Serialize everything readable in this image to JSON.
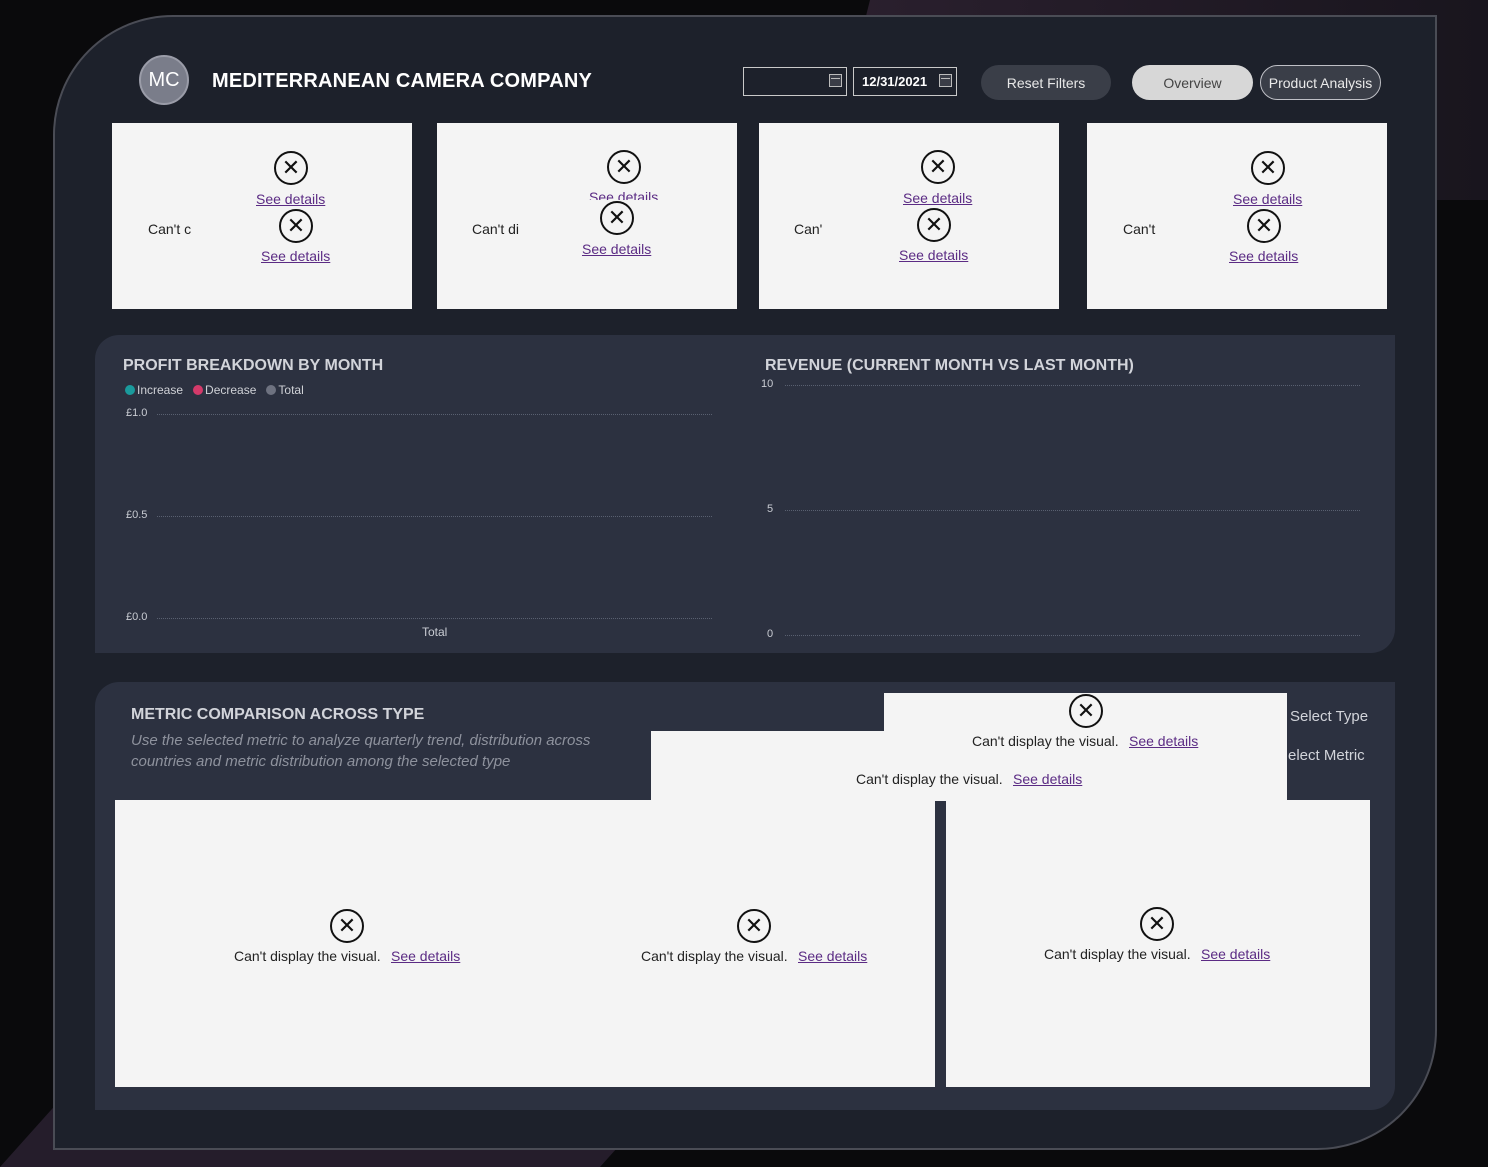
{
  "header": {
    "logo_initials": "MC",
    "company_name": "MEDITERRANEAN CAMERA COMPANY",
    "date_start": "",
    "date_end": "12/31/2021",
    "buttons": {
      "reset": "Reset Filters",
      "overview": "Overview",
      "product_analysis": "Product Analysis"
    }
  },
  "kpi_cards": [
    {
      "cant_text": "Can't c",
      "see_top": "See details",
      "see_bottom": "See details"
    },
    {
      "cant_text": "Can't di",
      "see_top": "See details",
      "see_bottom": "See details"
    },
    {
      "cant_text": "Can'",
      "see_top": "See details",
      "see_bottom": "See details"
    },
    {
      "cant_text": "Can't",
      "see_top": "See details",
      "see_bottom": "See details"
    }
  ],
  "profit_chart": {
    "title": "PROFIT BREAKDOWN BY MONTH",
    "legend": [
      {
        "label": "Increase",
        "color": "#1a9a9c"
      },
      {
        "label": "Decrease",
        "color": "#d43a6a"
      },
      {
        "label": "Total",
        "color": "#6e7280"
      }
    ],
    "y_ticks": [
      "£1.0",
      "£0.5",
      "£0.0"
    ],
    "x_label": "Total"
  },
  "revenue_chart": {
    "title": "REVENUE (CURRENT MONTH VS LAST MONTH)",
    "y_ticks": [
      "10",
      "5",
      "0"
    ]
  },
  "metric_section": {
    "title": "METRIC COMPARISON ACROSS TYPE",
    "subtitle": "Use the selected metric to analyze quarterly trend, distribution across countries and metric distribution among the selected type",
    "select_type_label": "Select Type",
    "select_metric_label": "elect Metric",
    "error_text": "Can't display the visual.",
    "see_details": "See details"
  }
}
